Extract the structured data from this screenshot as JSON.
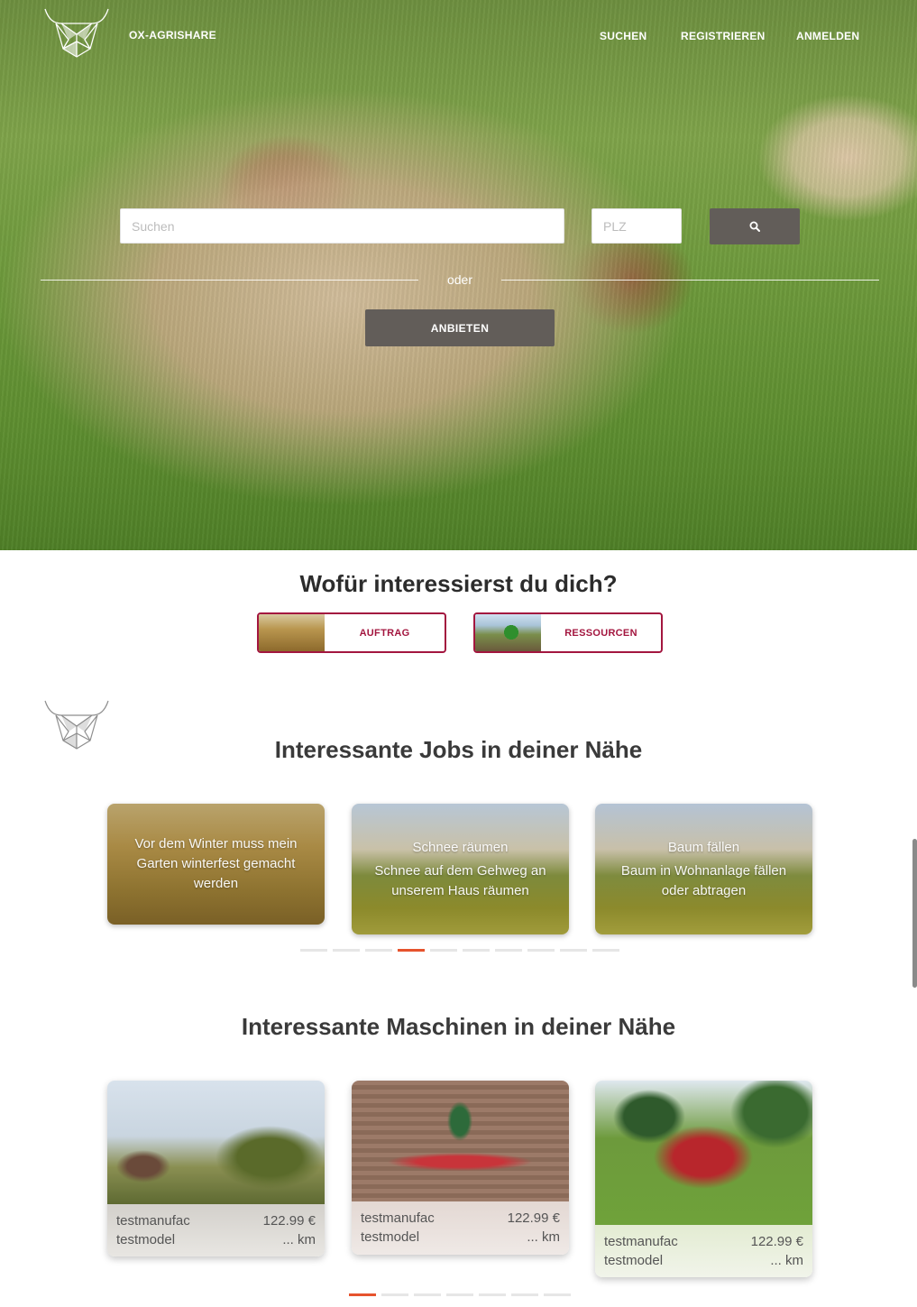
{
  "brand": {
    "name": "OX-AGRISHARE",
    "logo_icon": "ox-head-icon"
  },
  "nav": {
    "items": [
      {
        "label": "SUCHEN"
      },
      {
        "label": "REGISTRIEREN"
      },
      {
        "label": "ANMELDEN"
      }
    ]
  },
  "hero": {
    "search_placeholder": "Suchen",
    "search_value": "",
    "plz_placeholder": "PLZ",
    "plz_value": "",
    "search_button_icon": "search-icon",
    "divider_text": "oder",
    "offer_button": "ANBIETEN"
  },
  "interest": {
    "title": "Wofür interessierst du dich?",
    "options": [
      {
        "label": "AUFTRAG"
      },
      {
        "label": "RESSOURCEN"
      }
    ]
  },
  "jobs": {
    "title": "Interessante Jobs in deiner Nähe",
    "cards": [
      {
        "title": "",
        "description": "Vor dem Winter muss mein Garten winterfest gemacht werden"
      },
      {
        "title": "Schnee räumen",
        "description": "Schnee auf dem Gehweg an unserem Haus räumen"
      },
      {
        "title": "Baum fällen",
        "description": "Baum in Wohnanlage fällen oder abtragen"
      }
    ],
    "pager": {
      "count": 10,
      "active_index": 3
    }
  },
  "machines": {
    "title": "Interessante Maschinen in deiner Nähe",
    "cards": [
      {
        "manufacturer": "testmanufac",
        "model": "testmodel",
        "price": "122.99 €",
        "distance": "... km"
      },
      {
        "manufacturer": "testmanufac",
        "model": "testmodel",
        "price": "122.99 €",
        "distance": "... km"
      },
      {
        "manufacturer": "testmanufac",
        "model": "testmodel",
        "price": "122.99 €",
        "distance": "... km"
      }
    ],
    "pager": {
      "count": 7,
      "active_index": 0
    }
  },
  "colors": {
    "accent": "#a3163f",
    "button_dark": "#625d59",
    "pager_active": "#e6532d"
  }
}
